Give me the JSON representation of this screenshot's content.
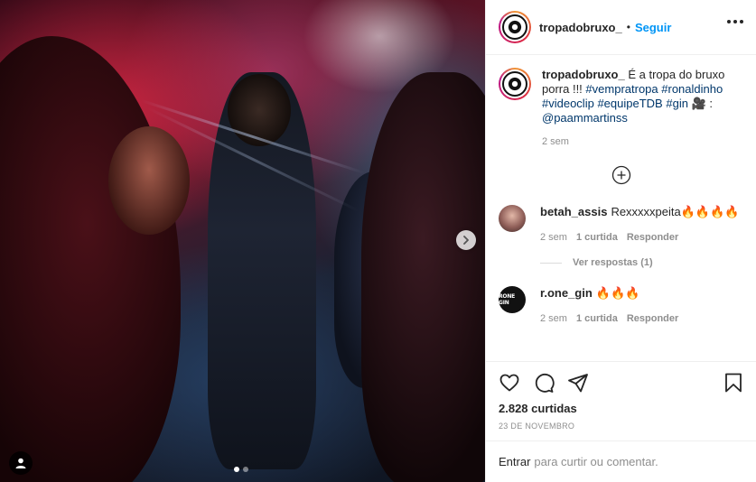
{
  "post": {
    "username": "tropadobruxo_",
    "follow_label": "Seguir",
    "separator": "•"
  },
  "caption": {
    "username": "tropadobruxo_",
    "text": "É a tropa do bruxo porra !!!",
    "hashtags": [
      "#vempratropa",
      "#ronaldinho",
      "#videoclip",
      "#equipeTDB",
      "#gin"
    ],
    "credit_prefix": "🎥 :",
    "credit": "@paammartinss",
    "time": "2 sem"
  },
  "comments": [
    {
      "username": "betah_assis",
      "text": "Rexxxxxpeita🔥🔥🔥🔥",
      "time": "2 sem",
      "likes": "1 curtida",
      "reply_label": "Responder",
      "view_replies": "Ver respostas (1)"
    },
    {
      "username": "r.one_gin",
      "text": "🔥🔥🔥",
      "time": "2 sem",
      "likes": "1 curtida",
      "reply_label": "Responder",
      "avatar_text": "RONE GIN"
    }
  ],
  "stats": {
    "likes": "2.828 curtidas",
    "date": "23 DE NOVEMBRO"
  },
  "add_comment": {
    "emoji_label": "Entrar",
    "placeholder": "para curtir ou comentar."
  },
  "carousel": {
    "slides": 2,
    "active_index": 0
  },
  "colors": {
    "link": "#0095f6",
    "hashtag": "#00376b",
    "muted": "#8e8e8e"
  },
  "icons": [
    "more-icon",
    "load-more-plus-icon",
    "heart-icon",
    "comment-icon",
    "share-icon",
    "save-bookmark-icon",
    "next-arrow-icon",
    "user-tag-icon"
  ]
}
